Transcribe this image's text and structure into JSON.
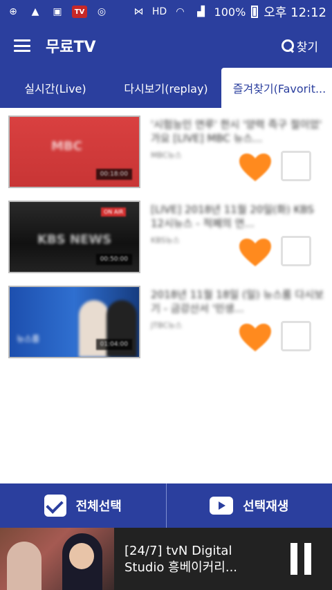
{
  "status": {
    "battery": "100%",
    "time": "오후 12:12",
    "hd": "HD"
  },
  "appbar": {
    "title": "무료TV",
    "search_label": "찾기"
  },
  "tabs": [
    {
      "label": "실시간(Live)"
    },
    {
      "label": "다시보기(replay)"
    },
    {
      "label": "즐겨찾기(Favorit..."
    }
  ],
  "items": [
    {
      "title": "'시험능인 연루' 한시 '양력 즉구 절이었' 가요 [LIVE] MBC 뉴스...",
      "sub": "MBC뉴스",
      "thumb_text": "MBC",
      "badge": "00:18:00",
      "heart_label": "즐겨"
    },
    {
      "title": "[LIVE] 2018년 11월 20일(화) KBS 12시뉴스 - 적폐의 연...",
      "sub": "KBS뉴스",
      "thumb_text": "KBS NEWS",
      "badge": "00:50:00",
      "live_tag": "ON AIR",
      "heart_label": "즐겨"
    },
    {
      "title": "2018년 11월 18일 (일) 뉴스룸 다시보기 - 금강산서 '민생...",
      "sub": "JTBC뉴스",
      "thumb_text": "뉴스룸",
      "badge": "01:04:00",
      "heart_label": "즐겨"
    }
  ],
  "bottombar": {
    "select_all": "전체선택",
    "play_selected": "선택재생"
  },
  "player": {
    "title": "[24/7] tvN Digital Studio 흥베이커리..."
  },
  "colors": {
    "primary": "#2b3f9e",
    "heart": "#ff8a1e"
  }
}
